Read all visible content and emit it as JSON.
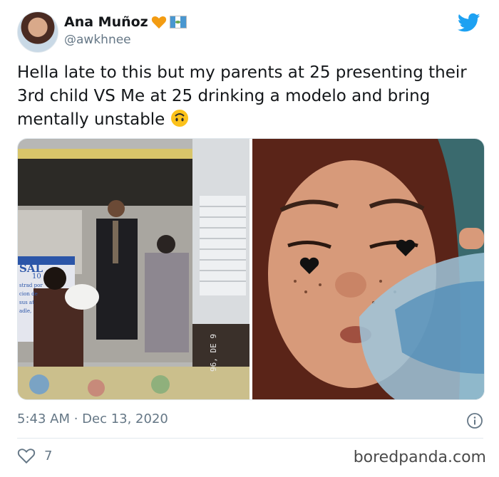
{
  "tweet": {
    "display_name": "Ana Muñoz",
    "handle": "@awkhnee",
    "text": "Hella late to this but my parents at 25 presenting their 3rd child VS Me at 25 drinking a modelo and bring mentally unstable",
    "timestamp": "5:43 AM · Dec 13, 2020",
    "likes": "7",
    "emoji_icon": "upside-down-face-icon",
    "name_emojis": [
      "orange-heart-icon",
      "guatemala-flag-icon"
    ]
  },
  "photos": {
    "left": {
      "sign_lines": [
        "SAL",
        "10",
        "strad por",
        "cion de",
        "sus at",
        "adle,"
      ],
      "photo_stamp": "96, DE 9"
    }
  },
  "watermark": "boredpanda.com",
  "colors": {
    "twitter_blue": "#1da1f2",
    "text": "#14171a",
    "secondary": "#657786"
  }
}
